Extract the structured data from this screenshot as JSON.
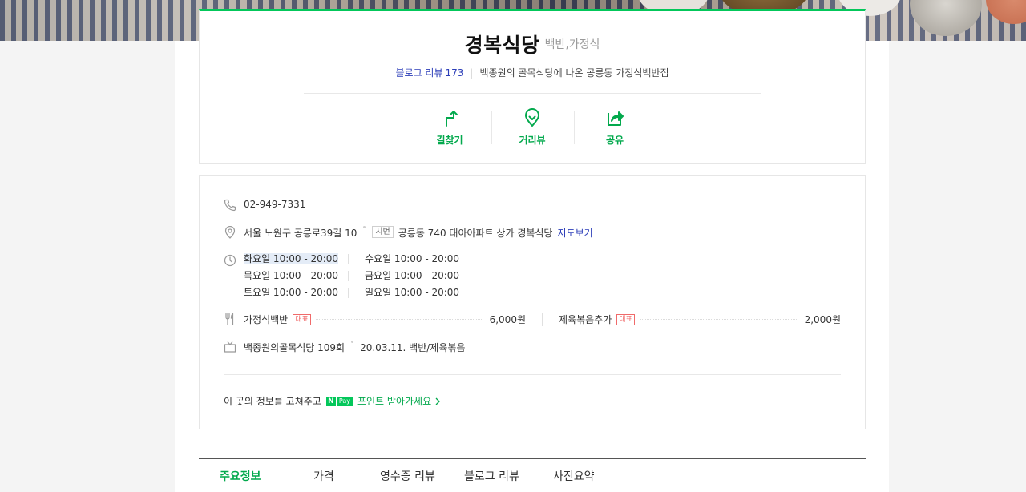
{
  "place": {
    "name": "경복식당",
    "category": "백반,가정식",
    "blog_review_label": "블로그 리뷰",
    "blog_review_count": "173",
    "description": "백종원의 골목식당에 나온 공릉동 가정식백반집"
  },
  "actions": [
    {
      "label": "길찾기",
      "icon": "directions-icon"
    },
    {
      "label": "거리뷰",
      "icon": "street-view-icon"
    },
    {
      "label": "공유",
      "icon": "share-icon"
    }
  ],
  "info": {
    "phone": "02-949-7331",
    "address": "서울 노원구 공릉로39길 10",
    "jibun_tag": "지번",
    "jibun_address": "공릉동 740 대아아파트 상가 경복식당",
    "map_link": "지도보기",
    "hours": [
      [
        "화요일 10:00 - 20:00",
        "수요일 10:00 - 20:00"
      ],
      [
        "목요일 10:00 - 20:00",
        "금요일 10:00 - 20:00"
      ],
      [
        "토요일 10:00 - 20:00",
        "일요일 10:00 - 20:00"
      ]
    ],
    "menu": [
      {
        "name": "가정식백반",
        "tag": "대표",
        "price": "6,000원"
      },
      {
        "name": "제육볶음추가",
        "tag": "대표",
        "price": "2,000원"
      }
    ],
    "tv_show": "백종원의골목식당 109회",
    "tv_detail": "20.03.11. 백반/제육볶음"
  },
  "promo": {
    "text": "이 곳의 정보를 고쳐주고",
    "npay_n": "N",
    "npay_pay": "Pay",
    "link": "포인트 받아가세요"
  },
  "tabs": [
    "주요정보",
    "가격",
    "영수증 리뷰",
    "블로그 리뷰",
    "사진요약"
  ],
  "colors": {
    "accent": "#03c75a",
    "link": "#2b3db8",
    "rep_tag": "#f06a6a"
  }
}
